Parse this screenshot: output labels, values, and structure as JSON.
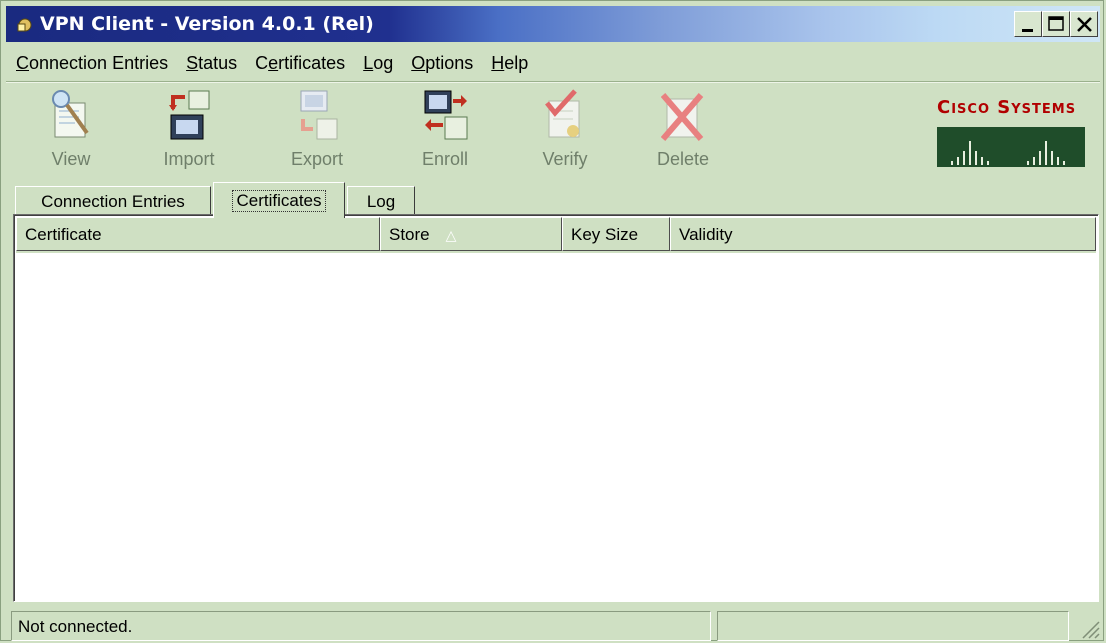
{
  "window": {
    "title": "VPN Client - Version 4.0.1 (Rel)",
    "minimize_label": "minimize",
    "maximize_label": "maximize",
    "close_label": "close"
  },
  "menu": [
    {
      "label": "Connection Entries",
      "key": "C"
    },
    {
      "label": "Status",
      "key": "S"
    },
    {
      "label": "Certificates",
      "key": "e"
    },
    {
      "label": "Log",
      "key": "L"
    },
    {
      "label": "Options",
      "key": "O"
    },
    {
      "label": "Help",
      "key": "H"
    }
  ],
  "toolbar": {
    "view": "View",
    "import": "Import",
    "export": "Export",
    "enroll": "Enroll",
    "verify": "Verify",
    "delete": "Delete"
  },
  "logo": {
    "text": "Cisco Systems",
    "icon": "cisco-logo"
  },
  "tabs": {
    "connection_entries": "Connection Entries",
    "certificates": "Certificates",
    "log": "Log",
    "active": "Certificates"
  },
  "table": {
    "columns": [
      "Certificate",
      "Store",
      "Key Size",
      "Validity"
    ],
    "sorted_column": "Store",
    "rows": []
  },
  "status": {
    "text": "Not connected.",
    "right_panel": ""
  },
  "colors": {
    "chrome": "#cfe0c3",
    "title_start": "#1a2a80",
    "title_end": "#cfe6f6",
    "logo_red": "#b10000",
    "logo_green": "#1f4d2a"
  }
}
